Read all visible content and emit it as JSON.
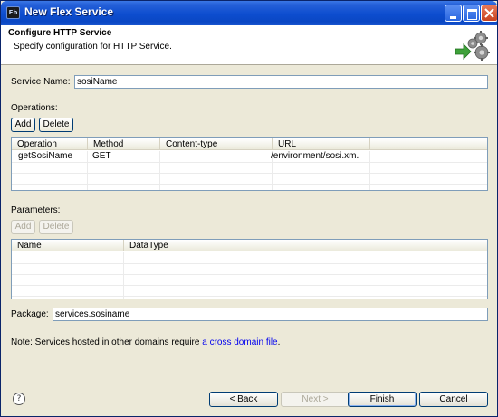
{
  "window": {
    "title": "New Flex Service",
    "app_icon_text": "Fb"
  },
  "banner": {
    "title": "Configure HTTP Service",
    "description": "Specify configuration for HTTP Service."
  },
  "form": {
    "service_name_label": "Service Name:",
    "service_name_value": "sosiName",
    "operations_label": "Operations:",
    "operations_add": "Add",
    "operations_delete": "Delete",
    "operations_columns": [
      "Operation",
      "Method",
      "Content-type",
      "URL"
    ],
    "operations_rows": [
      {
        "operation": "getSosiName",
        "method": "GET",
        "content_type": "",
        "url": "/environment/sosi.xm."
      }
    ],
    "parameters_label": "Parameters:",
    "parameters_add": "Add",
    "parameters_delete": "Delete",
    "parameters_columns": [
      "Name",
      "DataType"
    ],
    "package_label": "Package:",
    "package_value": "services.sosiname",
    "note_text": "Note: Services hosted in other domains require ",
    "note_link": "a cross domain file",
    "note_end": "."
  },
  "footer": {
    "help_symbol": "?",
    "back_label": "< Back",
    "next_label": "Next >",
    "finish_label": "Finish",
    "cancel_label": "Cancel"
  }
}
